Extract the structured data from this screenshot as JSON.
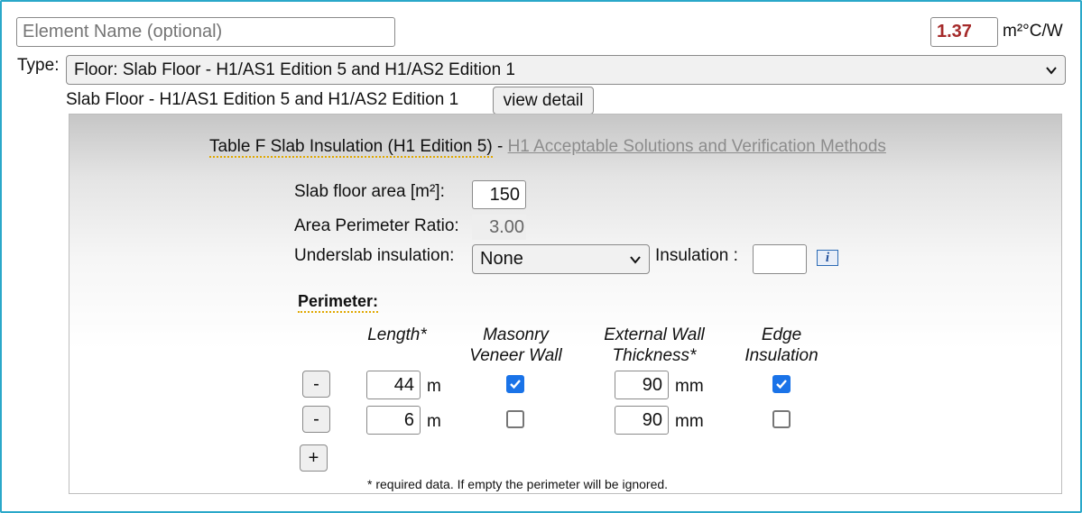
{
  "element_name": {
    "placeholder": "Element Name (optional)"
  },
  "r_value": {
    "value": "1.37",
    "unit": "m²°C/W"
  },
  "type": {
    "label": "Type:",
    "selected": "Floor: Slab Floor - H1/AS1 Edition 5 and H1/AS2 Edition 1",
    "description": "Slab Floor - H1/AS1 Edition 5 and H1/AS2 Edition 1",
    "view_detail_label": "view detail"
  },
  "panel": {
    "title": "Table F Slab Insulation (H1 Edition 5)",
    "title_sep": " - ",
    "link": "H1 Acceptable Solutions and Verification Methods",
    "slab_area_label": "Slab floor area [m²]:",
    "slab_area_value": "150",
    "apr_label": "Area Perimeter Ratio:",
    "apr_value": "3.00",
    "underslab_label": "Underslab insulation:",
    "underslab_selected": "None",
    "insulation_label": "Insulation :",
    "insulation_value": "",
    "info_icon_glyph": "i",
    "perimeter_label": "Perimeter:",
    "columns": {
      "length": "Length*",
      "masonry": "Masonry Veneer Wall",
      "thickness": "External Wall Thickness*",
      "edge": "Edge Insulation"
    },
    "rows": [
      {
        "remove": "-",
        "length": "44",
        "length_unit": "m",
        "masonry": true,
        "thickness": "90",
        "thickness_unit": "mm",
        "edge": true
      },
      {
        "remove": "-",
        "length": "6",
        "length_unit": "m",
        "masonry": false,
        "thickness": "90",
        "thickness_unit": "mm",
        "edge": false
      }
    ],
    "add_label": "+",
    "footnote": "* required data. If empty the perimeter will be ignored."
  },
  "colors": {
    "r_value_text": "#a52a2a",
    "frame_border": "#2aa8c9",
    "checkbox_on": "#1a73e8",
    "link": "#8c8c8c",
    "dotted_underline": "#e0a800"
  }
}
